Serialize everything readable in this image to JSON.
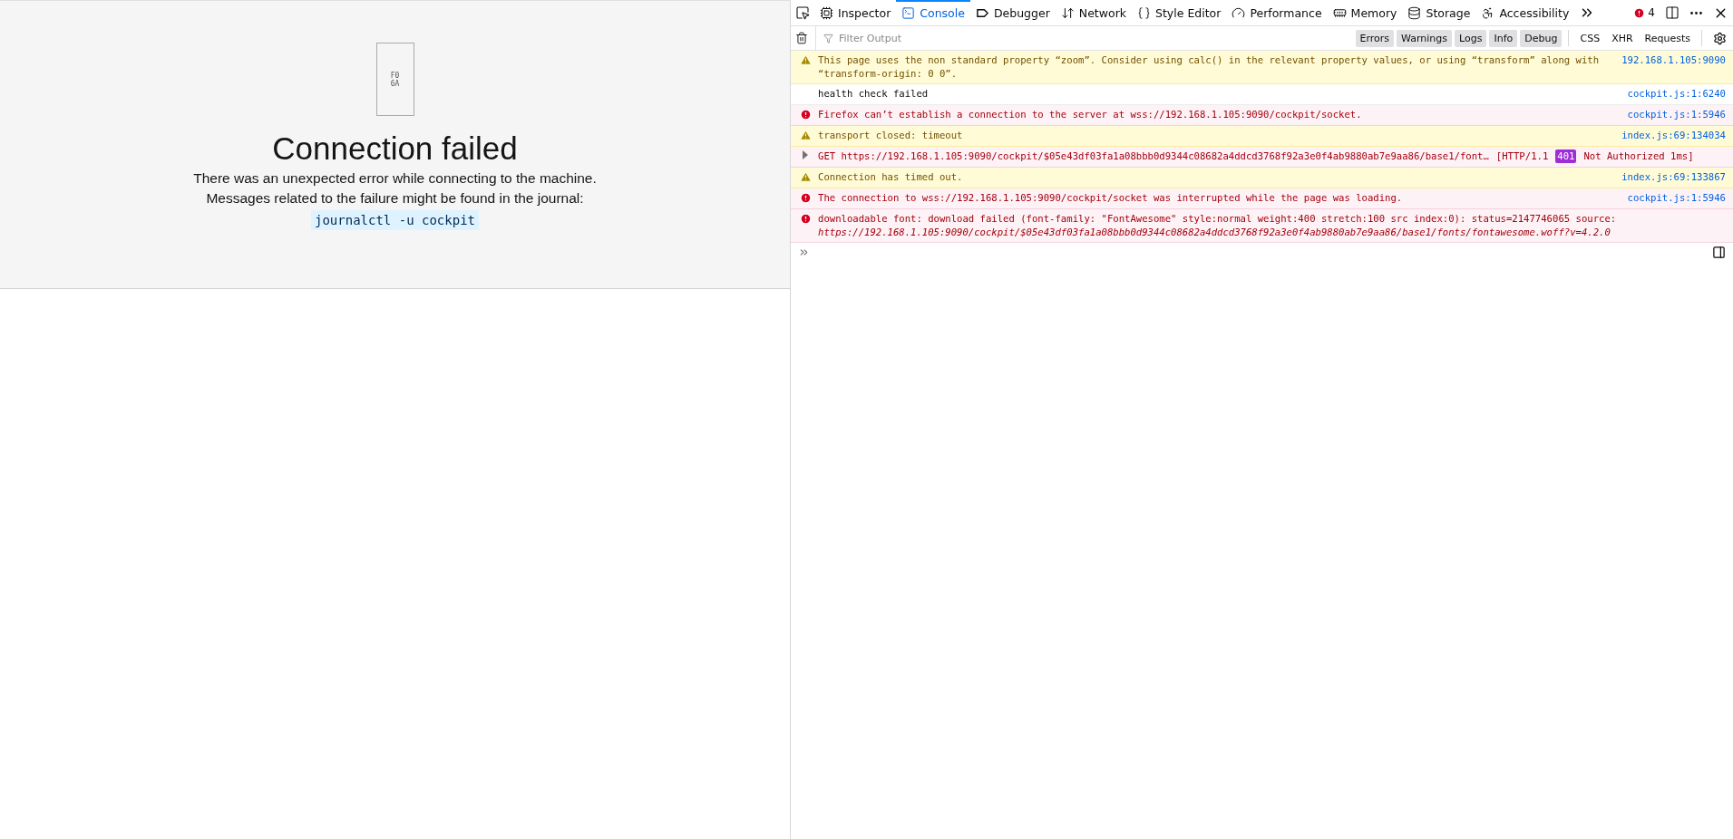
{
  "page": {
    "glyph_box": {
      "lines": [
        "F0",
        "6A"
      ]
    },
    "title": "Connection failed",
    "messages": [
      "There was an unexpected error while connecting to the machine.",
      "Messages related to the failure might be found in the journal:"
    ],
    "command": "journalctl -u cockpit"
  },
  "devtools": {
    "tabs": [
      {
        "label": "Inspector",
        "selected": false
      },
      {
        "label": "Console",
        "selected": true
      },
      {
        "label": "Debugger",
        "selected": false
      },
      {
        "label": "Network",
        "selected": false
      },
      {
        "label": "Style Editor",
        "selected": false
      },
      {
        "label": "Performance",
        "selected": false
      },
      {
        "label": "Memory",
        "selected": false
      },
      {
        "label": "Storage",
        "selected": false
      },
      {
        "label": "Accessibility",
        "selected": false
      }
    ],
    "error_count": "4",
    "filter": {
      "placeholder": "Filter Output"
    },
    "levels": [
      {
        "label": "Errors",
        "selected": true
      },
      {
        "label": "Warnings",
        "selected": true
      },
      {
        "label": "Logs",
        "selected": true
      },
      {
        "label": "Info",
        "selected": true
      },
      {
        "label": "Debug",
        "selected": true
      }
    ],
    "types": [
      {
        "label": "CSS",
        "selected": false
      },
      {
        "label": "XHR",
        "selected": false
      },
      {
        "label": "Requests",
        "selected": false
      }
    ],
    "console": [
      {
        "kind": "warning",
        "text": "This page uses the non standard property “zoom”. Consider using calc() in the relevant property values, or using “transform” along with “transform-origin: 0 0”.",
        "source": "192.168.1.105:9090"
      },
      {
        "kind": "log",
        "text": "health check failed",
        "source": "cockpit.js:1:6240"
      },
      {
        "kind": "error",
        "text": "Firefox can’t establish a connection to the server at wss://192.168.1.105:9090/cockpit/socket.",
        "source": "cockpit.js:1:5946"
      },
      {
        "kind": "warning",
        "text": "transport closed: timeout",
        "source": "index.js:69:134034"
      },
      {
        "kind": "network",
        "text": "GET https://192.168.1.105:9090/cockpit/$05e43df03fa1a08bbb0d9344c08682a4ddcd3768f92a3e0f4ab9880ab7e9aa86/base1/font…",
        "protocol": "[HTTP/1.1",
        "status": "401",
        "status_text": "Not Authorized 1ms]"
      },
      {
        "kind": "warning",
        "text": "Connection has timed out.",
        "source": "index.js:69:133867"
      },
      {
        "kind": "error",
        "text": "The connection to wss://192.168.1.105:9090/cockpit/socket was interrupted while the page was loading.",
        "source": "cockpit.js:1:5946"
      },
      {
        "kind": "error",
        "text": "downloadable font: download failed (font-family: \"FontAwesome\" style:normal weight:400 stretch:100 src index:0): status=2147746065 source:",
        "detail": "https://192.168.1.105:9090/cockpit/$05e43df03fa1a08bbb0d9344c08682a4ddcd3768f92a3e0f4ab9880ab7e9aa86/base1/fonts/fontawesome.woff?v=4.2.0"
      }
    ]
  }
}
